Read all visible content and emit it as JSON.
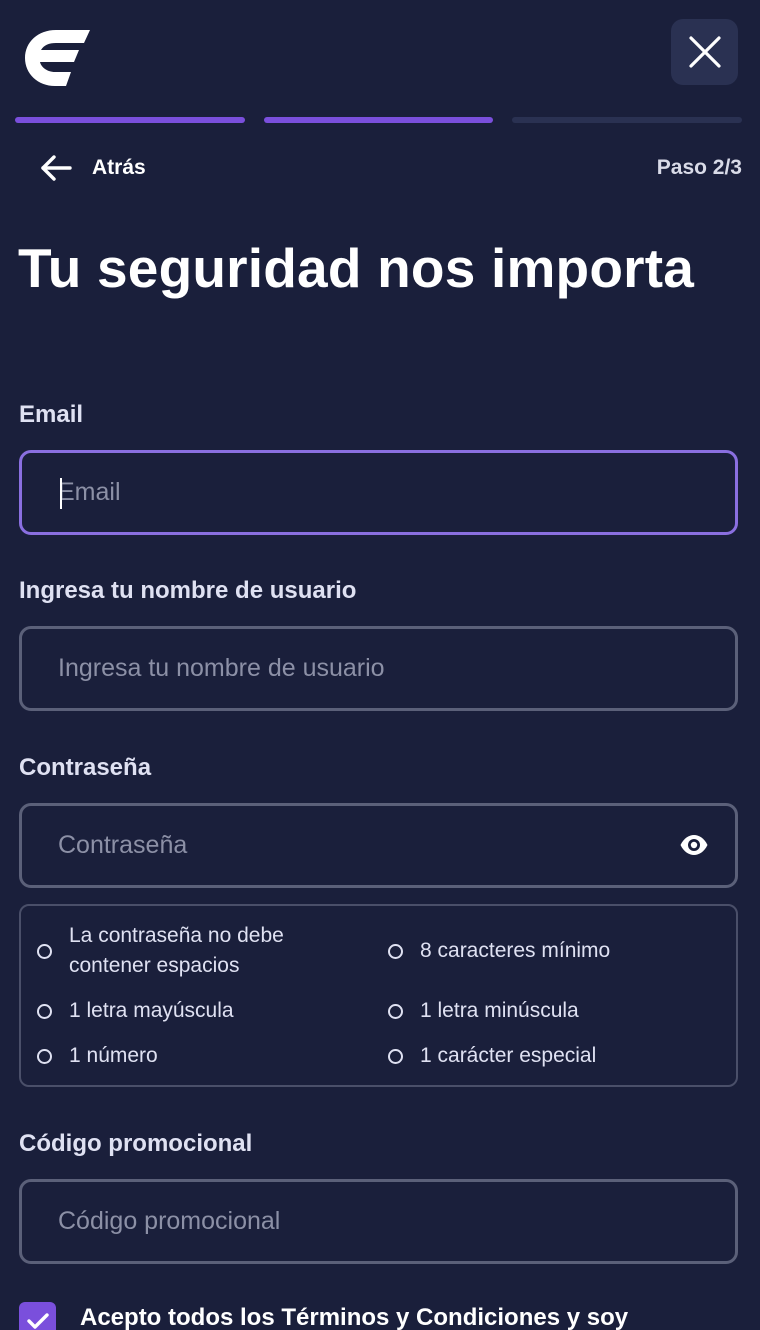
{
  "colors": {
    "background": "#1a1f3b",
    "accent": "#7a4fdc",
    "focus_border": "#8a6fe0",
    "field_border": "#5b6079",
    "progress_inactive": "#2a3152"
  },
  "header": {
    "logo_icon": "brand-logo-icon",
    "close_icon": "close-icon"
  },
  "progress": {
    "total_steps": 3,
    "completed_steps": 2
  },
  "nav": {
    "back_label": "Atrás",
    "step_label": "Paso 2/3"
  },
  "title": "Tu seguridad nos importa",
  "form": {
    "email": {
      "label": "Email",
      "placeholder": "Email",
      "value": ""
    },
    "username": {
      "label": "Ingresa tu nombre de usuario",
      "placeholder": "Ingresa tu nombre de usuario",
      "value": ""
    },
    "password": {
      "label": "Contraseña",
      "placeholder": "Contraseña",
      "value": "",
      "toggle_icon": "eye-icon"
    },
    "password_rules": [
      "La contraseña no debe contener espacios",
      "8 caracteres mínimo",
      "1 letra mayúscula",
      "1 letra minúscula",
      "1 número",
      "1 carácter especial"
    ],
    "promo": {
      "label": "Código promocional",
      "placeholder": "Código promocional",
      "value": ""
    },
    "terms": {
      "checked": true,
      "label": "Acepto todos los Términos y Condiciones y soy"
    }
  }
}
